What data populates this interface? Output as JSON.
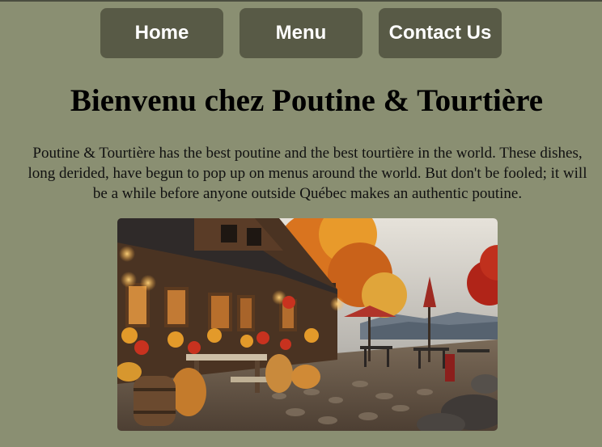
{
  "nav": {
    "items": [
      {
        "label": "Home"
      },
      {
        "label": "Menu"
      },
      {
        "label": "Contact Us"
      }
    ]
  },
  "main": {
    "title": "Bienvenu chez Poutine & Tourtière",
    "intro": "Poutine & Tourtière has the best poutine and the best tourtière in the world. These dishes, long derided, have begun to pop up on menus around the world. But don't be fooled; it will be a while before anyone outside Québec makes an authentic poutine."
  },
  "colors": {
    "background": "#8a8f72",
    "nav_button": "#585a46",
    "nav_text": "#ffffff"
  }
}
